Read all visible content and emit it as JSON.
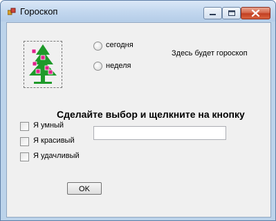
{
  "window": {
    "title": "Гороскоп",
    "buttons": {
      "minimize": "minimize-icon",
      "maximize": "maximize-icon",
      "close": "close-icon"
    }
  },
  "form": {
    "radios": [
      {
        "label": "сегодня",
        "checked": false
      },
      {
        "label": "неделя",
        "checked": false
      }
    ],
    "output_label": "Здесь будет гороскоп",
    "heading": "Сделайте выбор и щелкните на кнопку",
    "checkboxes": [
      {
        "label": "Я умный",
        "checked": false
      },
      {
        "label": "Я красивый",
        "checked": false
      },
      {
        "label": "Я удачливый",
        "checked": false
      }
    ],
    "text_value": "",
    "ok_label": "OK"
  },
  "colors": {
    "tree": "#1e9a2a",
    "flowers": "#e0218a",
    "close_button": "#c94b2e"
  }
}
